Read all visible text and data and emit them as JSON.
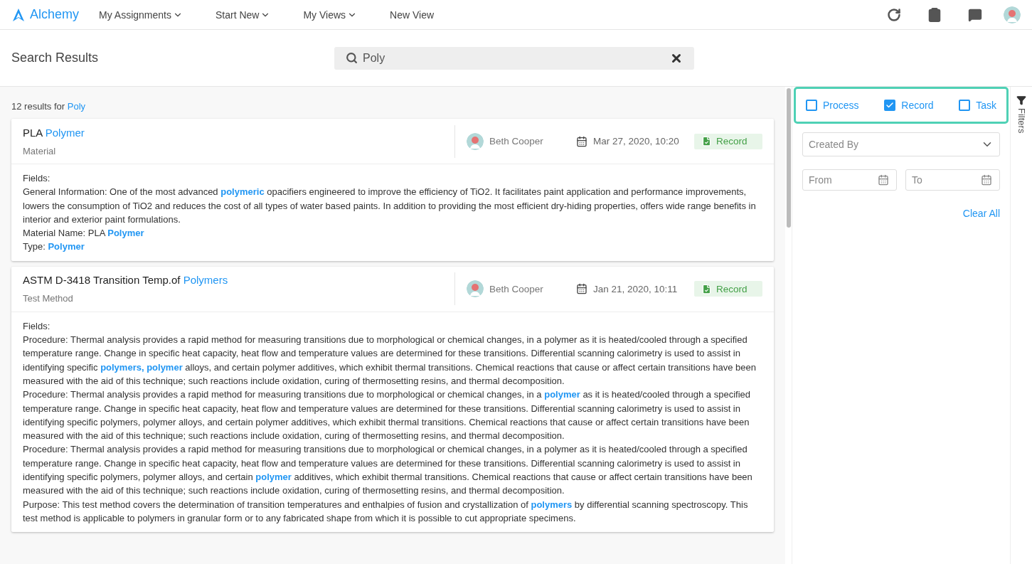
{
  "app": {
    "logo": "Alchemy"
  },
  "nav": [
    {
      "label": "My Assignments",
      "dropdown": true
    },
    {
      "label": "Start New",
      "dropdown": true
    },
    {
      "label": "My Views",
      "dropdown": true
    },
    {
      "label": "New View",
      "dropdown": false
    }
  ],
  "page_title": "Search Results",
  "search": {
    "value": "Poly"
  },
  "results_summary": {
    "count_text": "12 results for",
    "query": "Poly"
  },
  "results": [
    {
      "title": "PLA **Polymer**",
      "type": "Material",
      "author": "Beth Cooper",
      "date": "Mar 27, 2020, 10:20",
      "badge": "Record",
      "fields_label": "Fields:",
      "lines": [
        "General Information: One of the most advanced **polymeric** opacifiers engineered to improve the efficiency of TiO2. It facilitates paint application and performance improvements, lowers the consumption of TiO2 and reduces the cost of all types of water based paints. In addition to providing the most efficient dry-hiding properties, offers wide range benefits in interior and exterior paint formulations.",
        "Material Name: PLA **Polymer**",
        "Type: **Polymer**"
      ]
    },
    {
      "title": "ASTM D-3418 Transition Temp.of **Polymers**",
      "type": "Test Method",
      "author": "Beth Cooper",
      "date": "Jan 21, 2020, 10:11",
      "badge": "Record",
      "fields_label": "Fields:",
      "lines": [
        "Procedure: Thermal analysis provides a rapid method for measuring transitions due to morphological or chemical changes, in a polymer as it is heated/cooled through a specified temperature range. Change in specific heat capacity, heat flow and temperature values are determined for these transitions. Differential scanning calorimetry is used to assist in identifying specific **polymers, polymer** alloys, and certain polymer additives, which exhibit thermal transitions. Chemical reactions that cause or affect certain transitions have been measured with the aid of this technique; such reactions include oxidation, curing of thermosetting resins, and thermal decomposition.",
        "Procedure: Thermal analysis provides a rapid method for measuring transitions due to morphological or chemical changes, in a **polymer** as it is heated/cooled through a specified temperature range. Change in specific heat capacity, heat flow and temperature values are determined for these transitions. Differential scanning calorimetry is used to assist in identifying specific polymers, polymer alloys, and certain polymer additives, which exhibit thermal transitions. Chemical reactions that cause or affect certain transitions have been measured with the aid of this technique; such reactions include oxidation, curing of thermosetting resins, and thermal decomposition.",
        "Procedure: Thermal analysis provides a rapid method for measuring transitions due to morphological or chemical changes, in a polymer as it is heated/cooled through a specified temperature range. Change in specific heat capacity, heat flow and temperature values are determined for these transitions. Differential scanning calorimetry is used to assist in identifying specific polymers, polymer alloys, and certain **polymer** additives, which exhibit thermal transitions. Chemical reactions that cause or affect certain transitions have been measured with the aid of this technique; such reactions include oxidation, curing of thermosetting resins, and thermal decomposition.",
        "Purpose: This test method covers the determination of transition temperatures and enthalpies of fusion and crystallization of **polymers** by differential scanning spectroscopy. This test method is applicable to polymers in granular form or to any fabricated shape from which it is possible to cut appropriate specimens."
      ]
    }
  ],
  "filters": {
    "types": [
      {
        "label": "Process",
        "checked": false
      },
      {
        "label": "Record",
        "checked": true
      },
      {
        "label": "Task",
        "checked": false
      }
    ],
    "created_by": {
      "placeholder": "Created By"
    },
    "from": {
      "placeholder": "From"
    },
    "to": {
      "placeholder": "To"
    },
    "clear": "Clear All",
    "tab_label": "Filters"
  }
}
